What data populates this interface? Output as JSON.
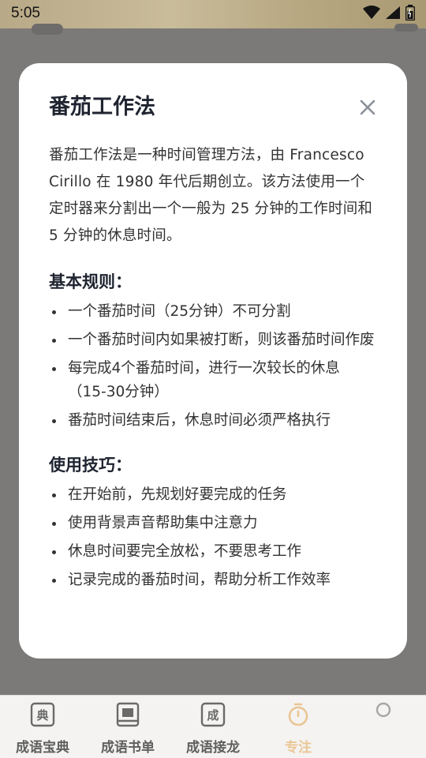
{
  "status_bar": {
    "time": "5:05",
    "icons": [
      "wifi-icon",
      "signal-icon",
      "battery-icon"
    ]
  },
  "modal": {
    "title": "番茄工作法",
    "intro": "番茄工作法是一种时间管理方法，由 Francesco Cirillo 在 1980 年代后期创立。该方法使用一个定时器来分割出一个一般为 25 分钟的工作时间和 5 分钟的休息时间。",
    "rules_title": "基本规则：",
    "rules": [
      "一个番茄时间（25分钟）不可分割",
      "一个番茄时间内如果被打断，则该番茄时间作废",
      "每完成4个番茄时间，进行一次较长的休息（15-30分钟）",
      "番茄时间结束后，休息时间必须严格执行"
    ],
    "tips_title": "使用技巧：",
    "tips": [
      "在开始前，先规划好要完成的任务",
      "使用背景声音帮助集中注意力",
      "休息时间要完全放松，不要思考工作",
      "记录完成的番茄时间，帮助分析工作效率"
    ],
    "close_icon": "close-icon"
  },
  "bottom_nav": {
    "items": [
      {
        "label": "成语宝典",
        "icon": "dictionary-icon",
        "glyph": "典"
      },
      {
        "label": "成语书单",
        "icon": "book-icon",
        "glyph": ""
      },
      {
        "label": "成语接龙",
        "icon": "idiom-chain-icon",
        "glyph": "成"
      },
      {
        "label": "专注",
        "icon": "timer-icon",
        "glyph": ""
      },
      {
        "label": "",
        "icon": "profile-icon",
        "glyph": ""
      }
    ],
    "active_color": "#e2a24a",
    "inactive_color": "#5f5f5f"
  }
}
